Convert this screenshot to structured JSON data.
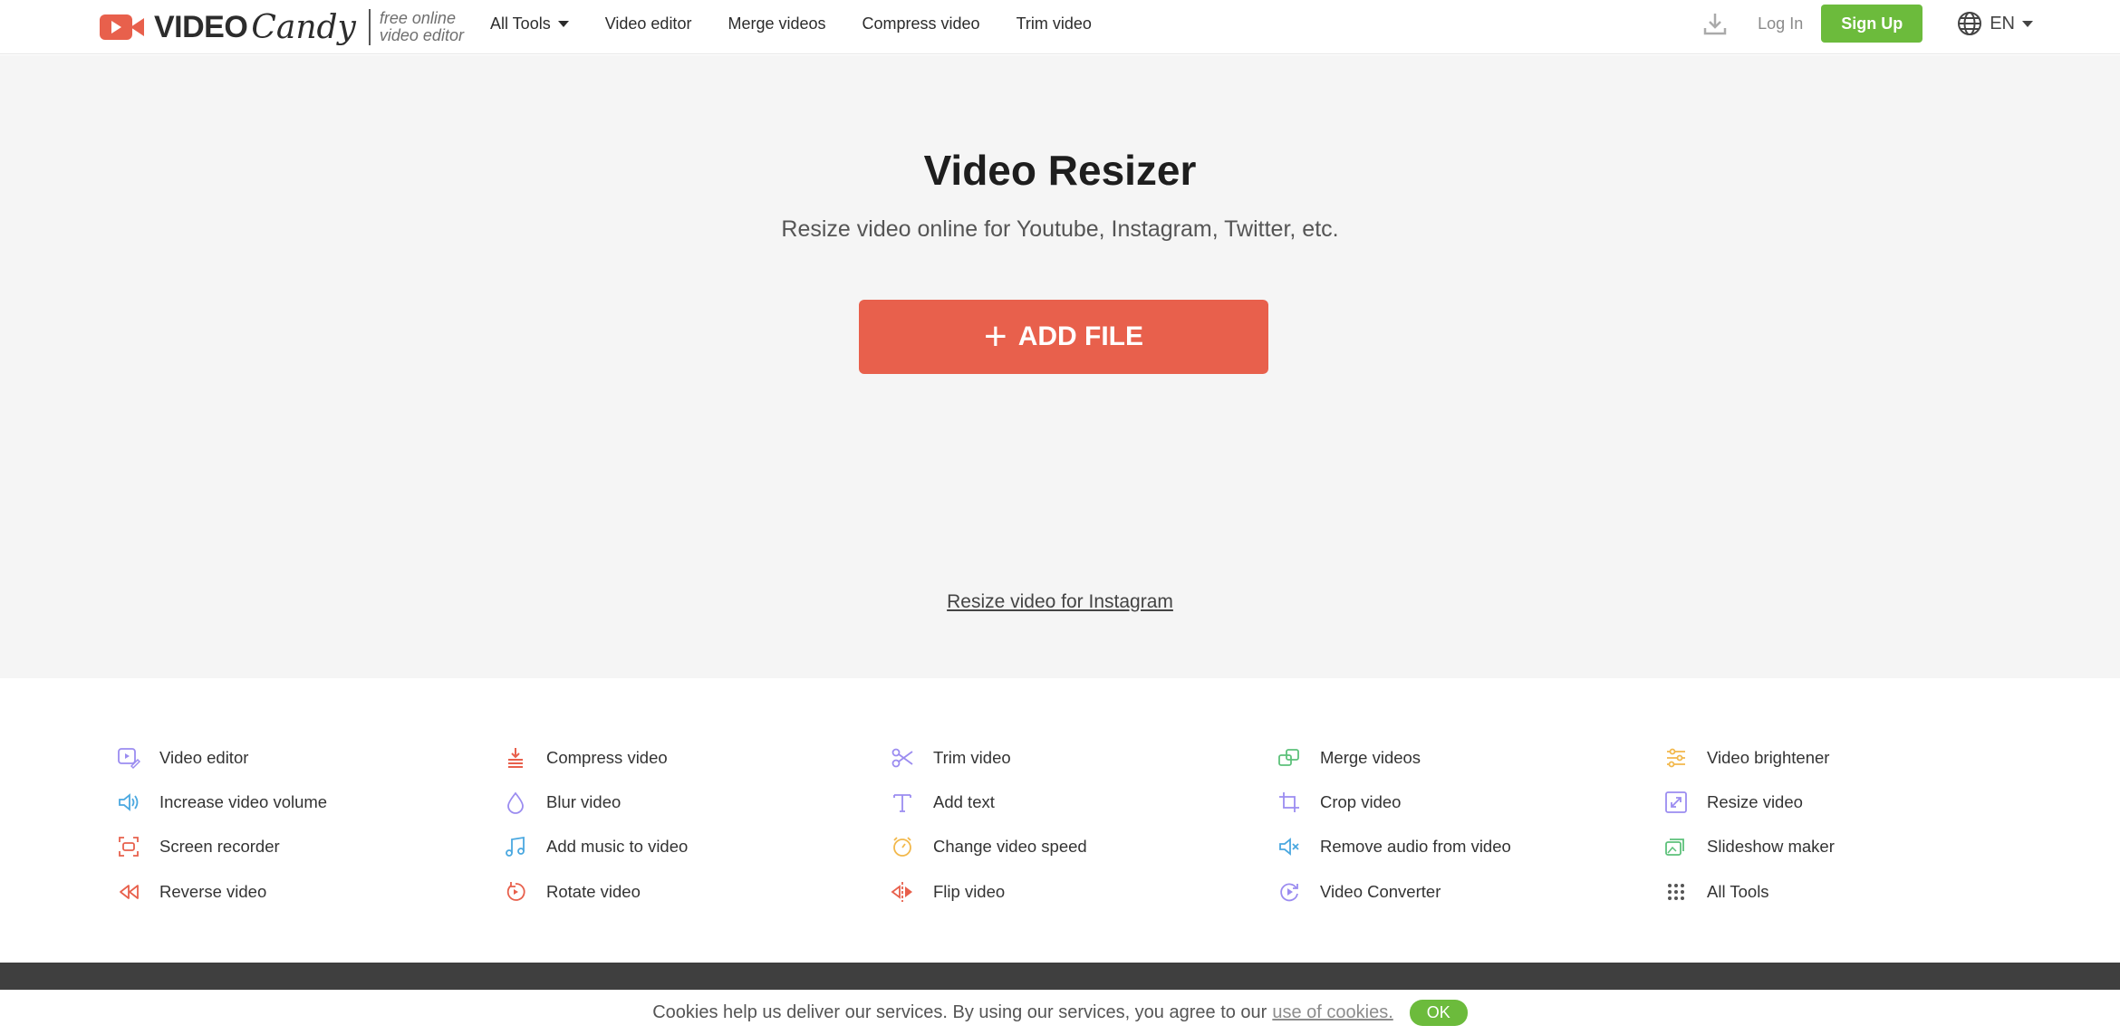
{
  "header": {
    "logo_word1": "VIDEO",
    "logo_word2": "Candy",
    "logo_tag_line1": "free online",
    "logo_tag_line2": "video editor",
    "nav": [
      {
        "label": "All Tools"
      },
      {
        "label": "Video editor"
      },
      {
        "label": "Merge videos"
      },
      {
        "label": "Compress video"
      },
      {
        "label": "Trim video"
      }
    ],
    "login": "Log In",
    "signup": "Sign Up",
    "lang": "EN"
  },
  "hero": {
    "title": "Video Resizer",
    "subtitle": "Resize video online for Youtube, Instagram, Twitter, etc.",
    "add_file": "ADD FILE",
    "instagram_link": "Resize video for Instagram"
  },
  "tools": [
    {
      "label": "Video editor",
      "icon": "video-edit-icon",
      "color": "#9b8cf0"
    },
    {
      "label": "Compress video",
      "icon": "compress-icon",
      "color": "#e8604c"
    },
    {
      "label": "Trim video",
      "icon": "scissors-icon",
      "color": "#9b8cf0"
    },
    {
      "label": "Merge videos",
      "icon": "merge-icon",
      "color": "#5cc17a"
    },
    {
      "label": "Video brightener",
      "icon": "sliders-icon",
      "color": "#f2b84b"
    },
    {
      "label": "Increase video volume",
      "icon": "volume-icon",
      "color": "#4aa8e0"
    },
    {
      "label": "Blur video",
      "icon": "drop-icon",
      "color": "#9b8cf0"
    },
    {
      "label": "Add text",
      "icon": "text-icon",
      "color": "#9b8cf0"
    },
    {
      "label": "Crop video",
      "icon": "crop-icon",
      "color": "#9b8cf0"
    },
    {
      "label": "Resize video",
      "icon": "resize-icon",
      "color": "#9b8cf0"
    },
    {
      "label": "Screen recorder",
      "icon": "screen-record-icon",
      "color": "#e8604c"
    },
    {
      "label": "Add music to video",
      "icon": "music-icon",
      "color": "#4aa8e0"
    },
    {
      "label": "Change video speed",
      "icon": "stopwatch-icon",
      "color": "#f2b84b"
    },
    {
      "label": "Remove audio from video",
      "icon": "mute-icon",
      "color": "#4aa8e0"
    },
    {
      "label": "Slideshow maker",
      "icon": "slideshow-icon",
      "color": "#5cc17a"
    },
    {
      "label": "Reverse video",
      "icon": "rewind-icon",
      "color": "#e8604c"
    },
    {
      "label": "Rotate video",
      "icon": "rotate-icon",
      "color": "#e8604c"
    },
    {
      "label": "Flip video",
      "icon": "flip-icon",
      "color": "#e8604c"
    },
    {
      "label": "Video Converter",
      "icon": "convert-icon",
      "color": "#9b8cf0"
    },
    {
      "label": "All Tools",
      "icon": "grid-icon",
      "color": "#555555"
    }
  ],
  "cookie": {
    "text": "Cookies help us deliver our services. By using our services, you agree to our",
    "link": "use of cookies.",
    "ok": "OK"
  },
  "colors": {
    "brand": "#e8604c",
    "signup": "#6cbb3c",
    "hero_bg": "#f5f5f5",
    "footer": "#3f3f3f"
  }
}
